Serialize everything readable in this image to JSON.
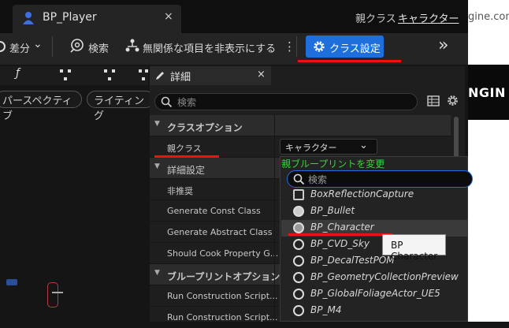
{
  "window": {
    "tab_title": "BP_Player",
    "tab_close": "×",
    "parent_label": "親クラス",
    "parent_value": "キャラクター"
  },
  "background_window": {
    "text_top": "gine.com",
    "text_mid": "NGIN"
  },
  "toolbar": {
    "diff_label": "差分",
    "diff_caret": "⌄",
    "search_label": "検索",
    "hide_label": "無関係な項目を非表示にする",
    "more": "⋮",
    "class_settings_label": "クラス設定",
    "expand": "»"
  },
  "left_panel": {
    "tab_icons": [
      "function-icon",
      "graph-icon",
      "graph-icon",
      "graph-icon"
    ],
    "tab_f": "ƒ",
    "perspective_label": "パースペクティブ",
    "lighting_label": "ライティング"
  },
  "details": {
    "tab_title": "詳細",
    "tab_close": "×",
    "search_placeholder": "検索",
    "rows": [
      {
        "label": "クラスオプション",
        "category": true
      },
      {
        "label": "親クラス",
        "category": false
      },
      {
        "label": "詳細設定",
        "category": true,
        "collapsed": true
      },
      {
        "label": "非推奨",
        "category": false
      },
      {
        "label": "Generate Const Class",
        "category": false
      },
      {
        "label": "Generate Abstract Class",
        "category": false
      },
      {
        "label": "Should Cook Property G...",
        "category": false
      },
      {
        "label": "ブループリントオプション",
        "category": true
      },
      {
        "label": "Run Construction Script...",
        "category": false
      },
      {
        "label": "Run Construction Script...",
        "category": false
      }
    ],
    "combo_value": "キャラクター"
  },
  "popup": {
    "title": "親ブループリントを変更",
    "search_placeholder": "検索",
    "items": [
      "BoxReflectionCapture",
      "BP_Bullet",
      "BP_Character",
      "BP_CVD_Sky",
      "BP_DecalTestPOM",
      "BP_GeometryCollectionPreview",
      "BP_GlobalFoliageActor_UE5",
      "BP_M4"
    ],
    "tooltip": "BP Character"
  },
  "colors": {
    "accent": "#1e6fdb",
    "highlight_red": "#e11111",
    "popup_title_green": "#3cd23c"
  }
}
